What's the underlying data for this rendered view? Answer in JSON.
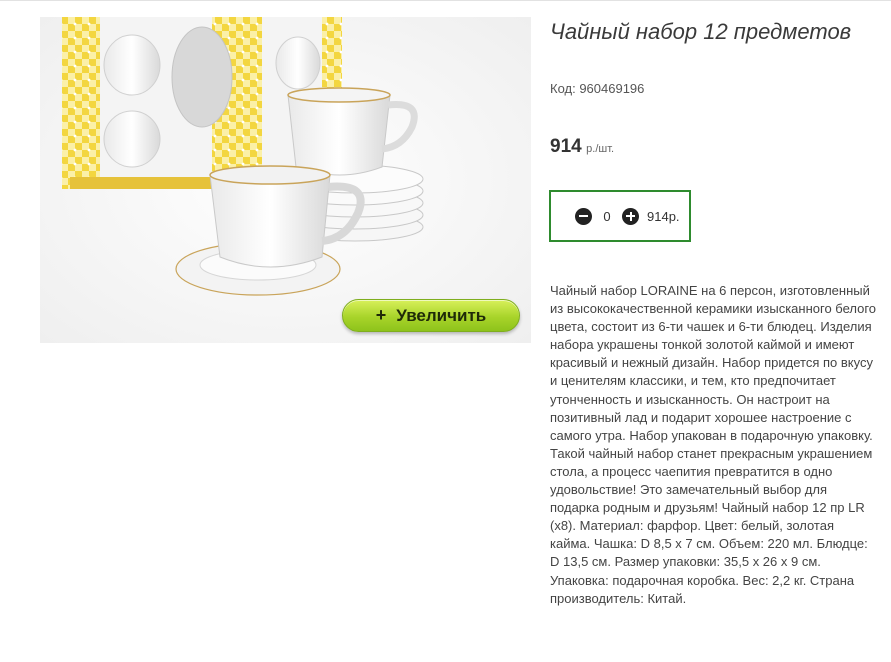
{
  "product": {
    "title": "Чайный набор 12 предметов",
    "sku": "Код: 960469196",
    "price": "914",
    "price_unit": "р./шт.",
    "quantity": "0",
    "total": "914р.",
    "zoom_button_symbol": "+",
    "zoom_button_label": "Увеличить",
    "description": "Чайный набор LORAINE на 6 персон, изготовленный из высококачественной керамики изысканного белого цвета, состоит из 6-ти чашек и 6-ти блюдец. Изделия набора украшены тонкой золотой каймой и имеют красивый и нежный дизайн. Набор придется по вкусу и ценителям классики, и тем, кто предпочитает утонченность и изысканность. Он настроит на позитивный лад и подарит хорошее настроение с самого утра. Набор упакован в подарочную упаковку. Такой чайный набор станет прекрасным украшением стола, а процесс чаепития превратится в одно удовольствие! Это замечательный выбор для подарка родным и друзьям! Чайный набор 12 пр LR (x8). Материал: фарфор. Цвет: белый, золотая кайма. Чашка: D 8,5 x 7 см. Объем: 220 мл. Блюдце: D 13,5 см. Размер упаковки: 35,5 x 26 x 9 см. Упаковка: подарочная коробка. Вес: 2,2 кг. Страна производитель: Китай."
  },
  "icons": {
    "decrease": "minus-circle-icon",
    "increase": "plus-circle-icon"
  },
  "colors": {
    "cart_border": "#2e8b2e",
    "zoom_button": "#a8d42a",
    "box_yellow": "#f2d23a"
  }
}
